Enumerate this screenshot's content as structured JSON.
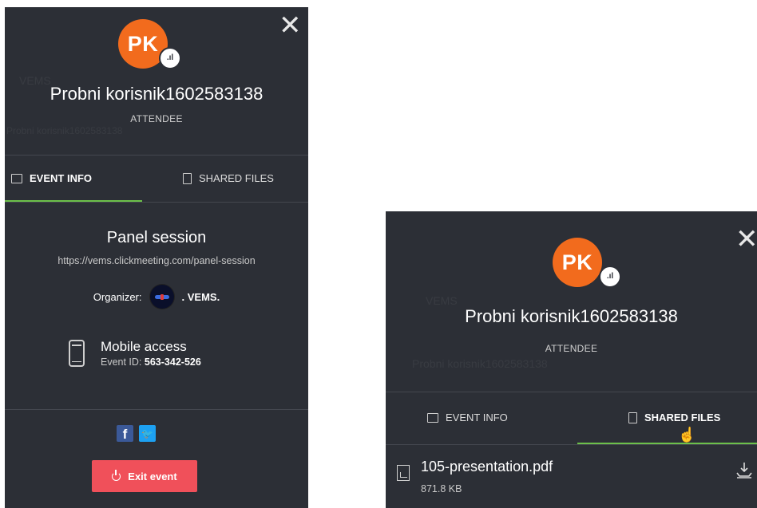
{
  "panel_left": {
    "user": {
      "initials": "PK",
      "name": "Probni korisnik1602583138",
      "role": "ATTENDEE"
    },
    "tabs": [
      {
        "label": "EVENT INFO",
        "active": true
      },
      {
        "label": "SHARED FILES",
        "active": false
      }
    ],
    "event": {
      "title": "Panel session",
      "url": "https://vems.clickmeeting.com/panel-session",
      "organizer_label": "Organizer:",
      "organizer_name": ". VEMS."
    },
    "mobile": {
      "title": "Mobile access",
      "event_id_label": "Event ID:",
      "event_id": "563-342-526"
    },
    "social": {
      "facebook": "f",
      "twitter": "t"
    },
    "exit_label": "Exit event",
    "background_ghost": {
      "row1": "VEMS",
      "row2": "Probni korisnik1602583138"
    }
  },
  "panel_right": {
    "user": {
      "initials": "PK",
      "name": "Probni korisnik1602583138",
      "role": "ATTENDEE"
    },
    "tabs": [
      {
        "label": "EVENT INFO",
        "active": false
      },
      {
        "label": "SHARED FILES",
        "active": true
      }
    ],
    "file": {
      "name": "105-presentation.pdf",
      "size": "871.8 KB"
    },
    "background_ghost": {
      "row1": "VEMS",
      "row2": "Probni korisnik1602583138"
    }
  },
  "colors": {
    "panel_bg": "#2c2f36",
    "avatar": "#f26b1d",
    "accent_green": "#6cc04a",
    "exit_button": "#f0505a",
    "facebook": "#3b5998",
    "twitter": "#1da1f2"
  }
}
